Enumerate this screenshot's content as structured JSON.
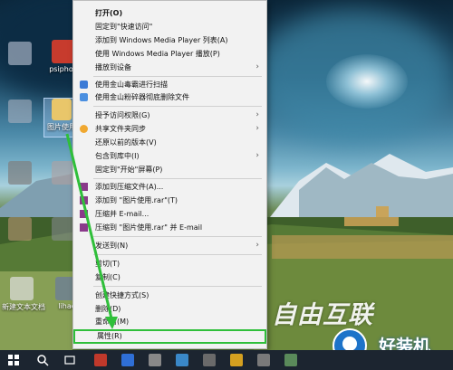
{
  "context_menu": {
    "items": [
      {
        "label": "打开(O)",
        "bold": true,
        "submenu": false
      },
      {
        "label": "固定到\"快速访问\"",
        "submenu": false
      },
      {
        "label": "添加到 Windows Media Player 列表(A)",
        "submenu": false
      },
      {
        "label": "使用 Windows Media Player 播放(P)",
        "submenu": false
      },
      {
        "label": "播放到设备",
        "submenu": true
      },
      {
        "label": "使用金山毒霸进行扫描",
        "submenu": false,
        "icon": "kingsoft-scan-icon"
      },
      {
        "label": "使用金山粉碎器彻底删除文件",
        "submenu": false,
        "icon": "kingsoft-shred-icon"
      },
      {
        "label": "授予访问权限(G)",
        "submenu": true
      },
      {
        "label": "共享文件夹同步",
        "submenu": true,
        "icon": "sync-icon"
      },
      {
        "label": "还原以前的版本(V)",
        "submenu": false
      },
      {
        "label": "包含到库中(I)",
        "submenu": true
      },
      {
        "label": "固定到\"开始\"屏幕(P)",
        "submenu": false
      },
      {
        "label": "添加到压缩文件(A)...",
        "submenu": false,
        "icon": "winrar-icon"
      },
      {
        "label": "添加到 \"图片使用.rar\"(T)",
        "submenu": false,
        "icon": "winrar-icon"
      },
      {
        "label": "压缩并 E-mail...",
        "submenu": false,
        "icon": "winrar-icon"
      },
      {
        "label": "压缩到 \"图片使用.rar\" 并 E-mail",
        "submenu": false,
        "icon": "winrar-icon"
      },
      {
        "label": "发送到(N)",
        "submenu": true
      },
      {
        "label": "剪切(T)",
        "submenu": false
      },
      {
        "label": "复制(C)",
        "submenu": false
      },
      {
        "label": "创建快捷方式(S)",
        "submenu": false
      },
      {
        "label": "删除(D)",
        "submenu": false
      },
      {
        "label": "重命名(M)",
        "submenu": false
      },
      {
        "label": "属性(R)",
        "submenu": false,
        "highlighted": true
      }
    ]
  },
  "desktop": {
    "icons": [
      {
        "caption": "psiphon"
      },
      {
        "caption": "图片使用"
      },
      {
        "caption": "新建文本文档"
      },
      {
        "caption": "lihao"
      }
    ]
  },
  "watermark": {
    "brand_text": "自由互联",
    "logo_text": "好装机"
  },
  "colors": {
    "highlight_green": "#2fbf3a",
    "menu_bg": "#f2f2f2",
    "taskbar": "#1c2530"
  }
}
